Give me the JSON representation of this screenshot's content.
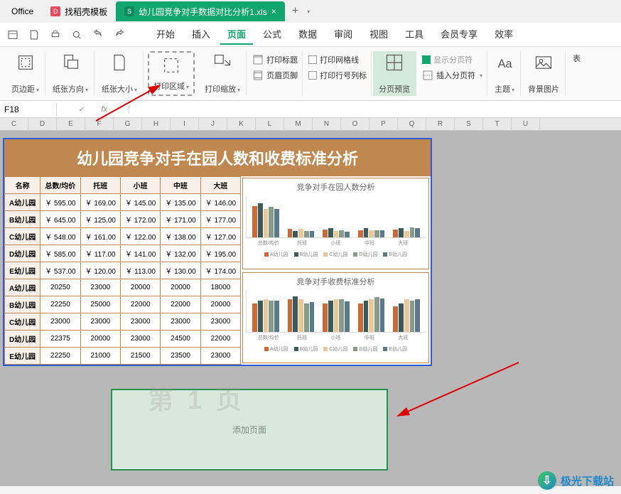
{
  "tabs": {
    "t0": "Office",
    "t1": "找稻壳模板",
    "t2": "幼儿园竞争对手数据对比分析1.xls",
    "close": "×",
    "plus": "+"
  },
  "menu": {
    "start": "开始",
    "insert": "插入",
    "page": "页面",
    "formula": "公式",
    "data": "数据",
    "review": "审阅",
    "view": "视图",
    "tool": "工具",
    "member": "会员专享",
    "efficiency": "效率"
  },
  "ribbon": {
    "margins": "页边距",
    "orient": "纸张方向",
    "size": "纸张大小",
    "printarea": "打印区域",
    "printscale": "打印缩放",
    "printtitle": "打印标题",
    "printgrid": "打印网格线",
    "headerfooter": "页眉页脚",
    "printrowcol": "打印行号列标",
    "pagebreak": "分页预览",
    "showbreak": "显示分页符",
    "insertbreak": "插入分页符",
    "theme": "主题",
    "bgimg": "背景图片",
    "table": "表"
  },
  "formula": {
    "cell": "F18",
    "fx": "fx"
  },
  "cols": [
    "C",
    "D",
    "E",
    "F",
    "G",
    "H",
    "I",
    "J",
    "K",
    "L",
    "M",
    "N",
    "O",
    "P",
    "Q",
    "R",
    "S",
    "T",
    "U"
  ],
  "sheet": {
    "title": "幼儿园竞争对手在园人数和收费标准分析",
    "headers": [
      "名称",
      "总数/均价",
      "托班",
      "小班",
      "中班",
      "大班"
    ],
    "rows": [
      [
        "A幼儿园",
        "￥ 595.00",
        "￥ 169.00",
        "￥ 145.00",
        "￥ 135.00",
        "￥ 146.00"
      ],
      [
        "B幼儿园",
        "￥ 645.00",
        "￥ 125.00",
        "￥ 172.00",
        "￥ 171.00",
        "￥ 177.00"
      ],
      [
        "C幼儿园",
        "￥ 548.00",
        "￥ 161.00",
        "￥ 122.00",
        "￥ 138.00",
        "￥ 127.00"
      ],
      [
        "D幼儿园",
        "￥ 585.00",
        "￥ 117.00",
        "￥ 141.00",
        "￥ 132.00",
        "￥ 195.00"
      ],
      [
        "E幼儿园",
        "￥ 537.00",
        "￥ 120.00",
        "￥ 113.00",
        "￥ 130.00",
        "￥ 174.00"
      ],
      [
        "A幼儿园",
        "20250",
        "23000",
        "20000",
        "20000",
        "18000"
      ],
      [
        "B幼儿园",
        "22250",
        "25000",
        "22000",
        "22000",
        "20000"
      ],
      [
        "C幼儿园",
        "23000",
        "23000",
        "23000",
        "23000",
        "23000"
      ],
      [
        "D幼儿园",
        "22375",
        "20000",
        "23000",
        "24500",
        "22000"
      ],
      [
        "E幼儿园",
        "22250",
        "21000",
        "21500",
        "23500",
        "23000"
      ]
    ],
    "addpage": "添加页面"
  },
  "chart_data": [
    {
      "type": "bar",
      "title": "竞争对手在园人数分析",
      "categories": [
        "总数/均价",
        "托班",
        "小班",
        "中班",
        "大班"
      ],
      "series": [
        {
          "name": "A幼儿园",
          "color": "#c96a3a",
          "values": [
            595,
            169,
            145,
            135,
            146
          ]
        },
        {
          "name": "B幼儿园",
          "color": "#3d5a5a",
          "values": [
            645,
            125,
            172,
            171,
            177
          ]
        },
        {
          "name": "C幼儿园",
          "color": "#e8c898",
          "values": [
            548,
            161,
            122,
            138,
            127
          ]
        },
        {
          "name": "D幼儿园",
          "color": "#8a9a8a",
          "values": [
            585,
            117,
            141,
            132,
            195
          ]
        },
        {
          "name": "E幼儿园",
          "color": "#5a7a8a",
          "values": [
            537,
            120,
            113,
            130,
            174
          ]
        }
      ],
      "ylim": [
        0,
        800
      ]
    },
    {
      "type": "bar",
      "title": "竞争对手收费标准分析",
      "categories": [
        "总数/均价",
        "托班",
        "小班",
        "中班",
        "大班"
      ],
      "series": [
        {
          "name": "A幼儿园",
          "color": "#c96a3a",
          "values": [
            20250,
            23000,
            20000,
            20000,
            18000
          ]
        },
        {
          "name": "B幼儿园",
          "color": "#3d5a5a",
          "values": [
            22250,
            25000,
            22000,
            22000,
            20000
          ]
        },
        {
          "name": "C幼儿园",
          "color": "#e8c898",
          "values": [
            23000,
            23000,
            23000,
            23000,
            23000
          ]
        },
        {
          "name": "D幼儿园",
          "color": "#8a9a8a",
          "values": [
            22375,
            20000,
            23000,
            24500,
            22000
          ]
        },
        {
          "name": "E幼儿园",
          "color": "#5a7a8a",
          "values": [
            22250,
            21000,
            21500,
            23500,
            23000
          ]
        }
      ],
      "ylim": [
        0,
        30000
      ],
      "yticks": [
        0,
        5000,
        10000,
        15000,
        20000,
        25000,
        30000
      ]
    }
  ],
  "logo": "极光下载站"
}
